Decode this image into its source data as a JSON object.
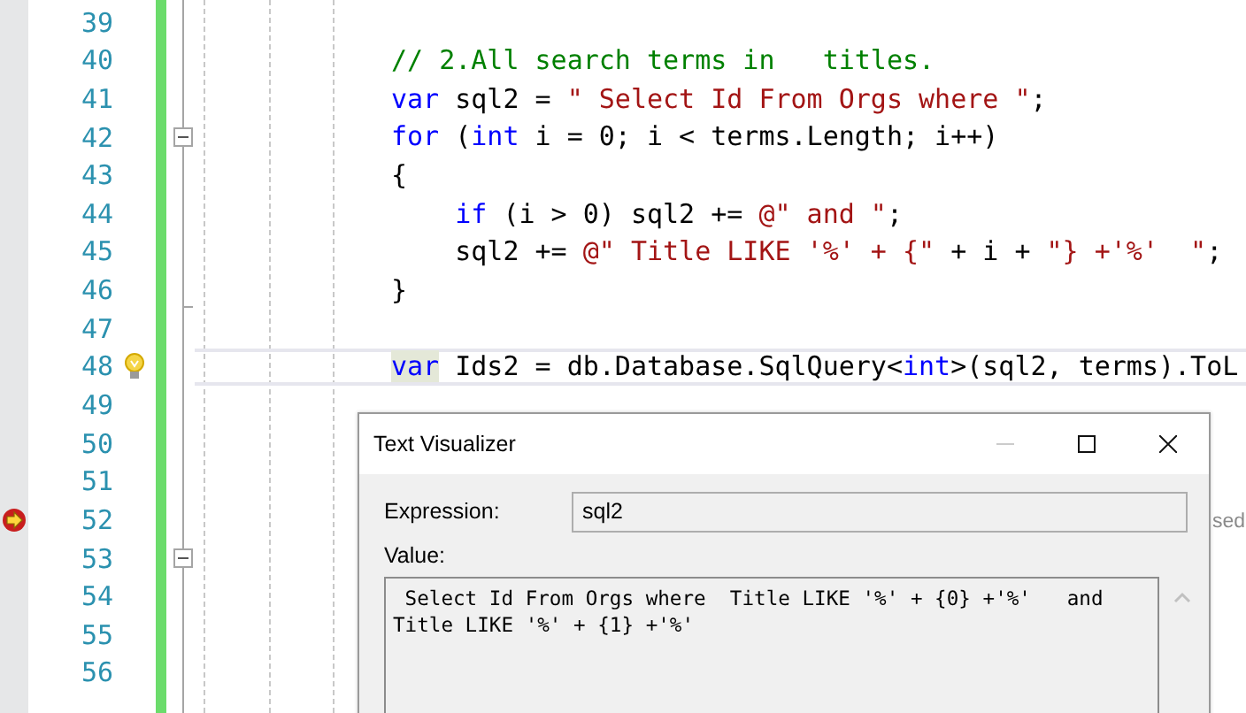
{
  "editor": {
    "lines": [
      {
        "number": "39",
        "current": false
      },
      {
        "number": "40",
        "current": false,
        "tokens": [
          {
            "kind": "comment",
            "text": "// 2.All search terms in   titles."
          }
        ]
      },
      {
        "number": "41",
        "current": false,
        "tokens": [
          {
            "kind": "keyword",
            "text": "var"
          },
          {
            "kind": "plain",
            "text": " sql2 = "
          },
          {
            "kind": "string",
            "text": "\" Select Id From Orgs where \""
          },
          {
            "kind": "plain",
            "text": ";"
          }
        ]
      },
      {
        "number": "42",
        "current": false,
        "fold": {
          "kind": "collapse"
        },
        "tokens": [
          {
            "kind": "keyword",
            "text": "for"
          },
          {
            "kind": "plain",
            "text": " ("
          },
          {
            "kind": "keyword",
            "text": "int"
          },
          {
            "kind": "plain",
            "text": " i = 0; i < terms.Length; i++)"
          }
        ]
      },
      {
        "number": "43",
        "current": false,
        "tokens": [
          {
            "kind": "plain",
            "text": "{"
          }
        ]
      },
      {
        "number": "44",
        "current": false,
        "tokens": [
          {
            "kind": "keyword",
            "text": "    if"
          },
          {
            "kind": "plain",
            "text": " (i > 0) sql2 += "
          },
          {
            "kind": "string",
            "text": "@\" and \""
          },
          {
            "kind": "plain",
            "text": ";"
          }
        ]
      },
      {
        "number": "45",
        "current": false,
        "tokens": [
          {
            "kind": "plain",
            "text": "    sql2 += "
          },
          {
            "kind": "string",
            "text": "@\" Title LIKE '%' + {\""
          },
          {
            "kind": "plain",
            "text": " + i + "
          },
          {
            "kind": "string",
            "text": "\"} +'%'  \""
          },
          {
            "kind": "plain",
            "text": ";"
          }
        ]
      },
      {
        "number": "46",
        "current": false,
        "fold": {
          "kind": "end"
        },
        "tokens": [
          {
            "kind": "plain",
            "text": "}"
          }
        ]
      },
      {
        "number": "47",
        "current": false
      },
      {
        "number": "48",
        "current": true,
        "marker": {
          "kind": "lightbulb"
        },
        "tokens": [
          {
            "kind": "highlighted_keyword",
            "text": "var"
          },
          {
            "kind": "plain",
            "text": " Ids2 = db.Database.SqlQuery<"
          },
          {
            "kind": "keyword",
            "text": "int"
          },
          {
            "kind": "plain",
            "text": ">(sql2, terms).ToL"
          }
        ]
      },
      {
        "number": "49",
        "current": false
      },
      {
        "number": "50",
        "current": false
      },
      {
        "number": "51",
        "current": false
      },
      {
        "number": "52",
        "current": false,
        "marker": {
          "kind": "current_statement"
        }
      },
      {
        "number": "53",
        "current": false,
        "fold": {
          "kind": "collapse"
        }
      },
      {
        "number": "54",
        "current": false
      },
      {
        "number": "55",
        "current": false
      },
      {
        "number": "56",
        "current": false
      }
    ],
    "text_behind_dialog": "sed"
  },
  "dialog": {
    "title": "Text Visualizer",
    "window_controls": [
      {
        "kind": "minimize",
        "disabled": true
      },
      {
        "kind": "maximize",
        "disabled": false
      },
      {
        "kind": "close",
        "disabled": false
      }
    ],
    "expression_label": "Expression:",
    "expression_value": "sql2",
    "value_label": "Value:",
    "value_lines": [
      " Select Id From Orgs where  Title LIKE '%' + {0} +'%'   and",
      "Title LIKE '%' + {1} +'%'"
    ]
  }
}
